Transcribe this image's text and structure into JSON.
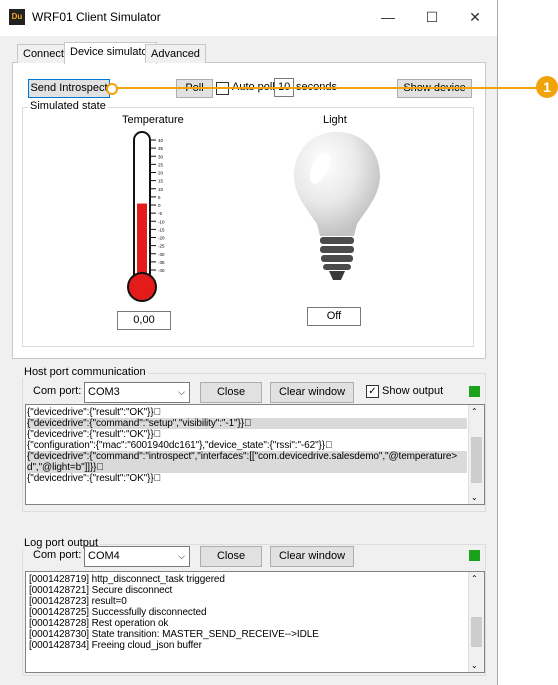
{
  "window": {
    "title": "WRF01 Client Simulator",
    "icon_text": "Du",
    "controls": {
      "minimize": "—",
      "maximize": "☐",
      "close": "✕"
    }
  },
  "tabs": [
    "Connect",
    "Device simulator",
    "Advanced"
  ],
  "toolbar": {
    "send_introspect": "Send Introspect",
    "poll": "Poll",
    "auto_poll": "Auto poll",
    "interval": "10",
    "seconds": "seconds",
    "show_device": "Show device"
  },
  "callout": {
    "number": "1",
    "color": "#f0a30a"
  },
  "simulated": {
    "group_title": "Simulated state",
    "temperature_label": "Temperature",
    "temperature_value": "0,00",
    "temperature_fill_fraction": 0.53,
    "scale": [
      "40",
      "35",
      "30",
      "25",
      "20",
      "15",
      "10",
      "5",
      "0",
      "-5",
      "-10",
      "-15",
      "-20",
      "-25",
      "-30",
      "-35",
      "-40"
    ],
    "light_label": "Light",
    "light_value": "Off"
  },
  "host": {
    "group_title": "Host port communication",
    "com_label": "Com port:",
    "com_value": "COM3",
    "close": "Close",
    "clear": "Clear window",
    "show_output": "Show output",
    "lines": [
      "{\"devicedrive\":{\"result\":\"OK\"}}\u0000",
      "{\"devicedrive\":{\"command\":\"setup\",\"visibility\":\"-1\"}}\u0000",
      "{\"devicedrive\":{\"result\":\"OK\"}}\u0000",
      "{\"configuration\":{\"mac\":\"6001940dc161\"},\"device_state\":{\"rssi\":\"-62\"}}\u0000",
      "{\"devicedrive\":{\"command\":\"introspect\",\"interfaces\":[[\"com.devicedrive.salesdemo\",\"@temperature>",
      "d\",\"@light=b\"]]}}\u0000",
      "{\"devicedrive\":{\"result\":\"OK\"}}\u0000"
    ]
  },
  "log": {
    "group_title": "Log port output",
    "com_label": "Com port:",
    "com_value": "COM4",
    "close": "Close",
    "clear": "Clear window",
    "lines": [
      "[0001428719] http_disconnect_task triggered",
      "[0001428721] Secure disconnect",
      "[0001428723] result=0",
      "[0001428725] Successfully disconnected",
      "[0001428728] Rest operation ok",
      "[0001428730] State transition: MASTER_SEND_RECEIVE-->IDLE",
      "[0001428734] Freeing cloud_json buffer"
    ]
  }
}
